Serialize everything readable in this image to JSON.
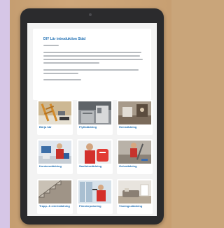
{
  "page": {
    "title": "DIY Lär introduktion Städ"
  },
  "services": [
    {
      "label": "Börja här",
      "icon": "ladder-photo"
    },
    {
      "label": "Flyttstädning",
      "icon": "kitchen-photo"
    },
    {
      "label": "Hemstädning",
      "icon": "interior-photo"
    },
    {
      "label": "Kontorsstädning",
      "icon": "office-cleaner-photo"
    },
    {
      "label": "Sanitetsstädning",
      "icon": "cleaner-bucket-photo"
    },
    {
      "label": "Golvstädning",
      "icon": "floor-mop-photo"
    },
    {
      "label": "Trapp- & entréstädning",
      "icon": "stairs-photo"
    },
    {
      "label": "Fönsterputsning",
      "icon": "window-cleaner-photo"
    },
    {
      "label": "Visningsstädning",
      "icon": "living-room-photo"
    }
  ],
  "colors": {
    "accent": "#1f6fb3",
    "bezel": "#2b2b2d",
    "screen_bg": "#f3f3f3"
  }
}
